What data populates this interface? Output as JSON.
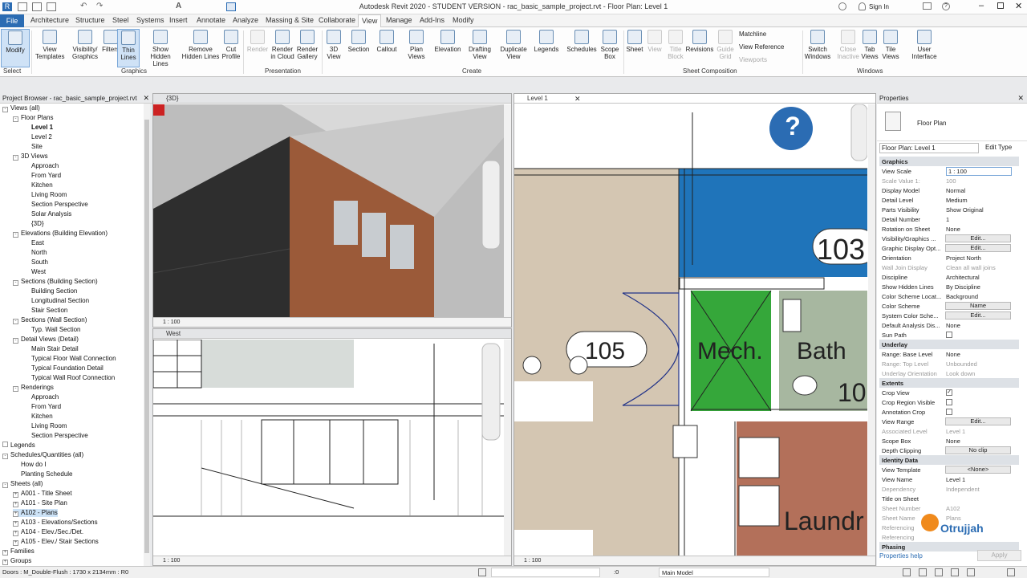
{
  "app": {
    "title": "Autodesk Revit 2020 - STUDENT VERSION - rac_basic_sample_project.rvt - Floor Plan: Level 1",
    "signin": "Sign In"
  },
  "tabs": [
    "File",
    "Architecture",
    "Structure",
    "Steel",
    "Systems",
    "Insert",
    "Annotate",
    "Analyze",
    "Massing & Site",
    "Collaborate",
    "View",
    "Manage",
    "Add-Ins",
    "Modify"
  ],
  "active_tab": "View",
  "ribbon": {
    "buttons": [
      {
        "id": "modify",
        "label": "Modify"
      },
      {
        "id": "view-templates",
        "label": "View\nTemplates"
      },
      {
        "id": "visibility-graphics",
        "label": "Visibility/\nGraphics"
      },
      {
        "id": "filters",
        "label": "Filters"
      },
      {
        "id": "thin-lines",
        "label": "Thin\nLines"
      },
      {
        "id": "show-hidden-lines",
        "label": "Show\nHidden Lines"
      },
      {
        "id": "remove-hidden-lines",
        "label": "Remove\nHidden Lines"
      },
      {
        "id": "cut-profile",
        "label": "Cut\nProfile"
      },
      {
        "id": "render",
        "label": "Render"
      },
      {
        "id": "render-in-cloud",
        "label": "Render\nin Cloud"
      },
      {
        "id": "render-gallery",
        "label": "Render\nGallery"
      },
      {
        "id": "3d-view",
        "label": "3D\nView"
      },
      {
        "id": "section",
        "label": "Section"
      },
      {
        "id": "callout",
        "label": "Callout"
      },
      {
        "id": "plan-views",
        "label": "Plan\nViews"
      },
      {
        "id": "elevation",
        "label": "Elevation"
      },
      {
        "id": "drafting-view",
        "label": "Drafting\nView"
      },
      {
        "id": "duplicate-view",
        "label": "Duplicate\nView"
      },
      {
        "id": "legends",
        "label": "Legends"
      },
      {
        "id": "schedules",
        "label": "Schedules"
      },
      {
        "id": "scope-box",
        "label": "Scope\nBox"
      },
      {
        "id": "sheet",
        "label": "Sheet"
      },
      {
        "id": "view",
        "label": "View"
      },
      {
        "id": "title-block",
        "label": "Title\nBlock"
      },
      {
        "id": "revisions",
        "label": "Revisions"
      },
      {
        "id": "guide-grid",
        "label": "Guide\nGrid"
      },
      {
        "id": "switch-windows",
        "label": "Switch\nWindows"
      },
      {
        "id": "close-inactive",
        "label": "Close\nInactive"
      },
      {
        "id": "tab-views",
        "label": "Tab\nViews"
      },
      {
        "id": "tile-views",
        "label": "Tile\nViews"
      },
      {
        "id": "user-interface",
        "label": "User\nInterface"
      }
    ],
    "small": [
      "Matchline",
      "View Reference",
      "Viewports"
    ],
    "panels": [
      "Select",
      "Graphics",
      "Presentation",
      "Create",
      "Sheet Composition",
      "Windows"
    ]
  },
  "browser": {
    "title": "Project Browser - rac_basic_sample_project.rvt",
    "items": [
      {
        "t": "Views (all)",
        "l": 1,
        "g": "-"
      },
      {
        "t": "Floor Plans",
        "l": 2,
        "g": "-"
      },
      {
        "t": "Level 1",
        "l": 3,
        "b": true
      },
      {
        "t": "Level 2",
        "l": 3
      },
      {
        "t": "Site",
        "l": 3
      },
      {
        "t": "3D Views",
        "l": 2,
        "g": "-"
      },
      {
        "t": "Approach",
        "l": 3
      },
      {
        "t": "From Yard",
        "l": 3
      },
      {
        "t": "Kitchen",
        "l": 3
      },
      {
        "t": "Living Room",
        "l": 3
      },
      {
        "t": "Section Perspective",
        "l": 3
      },
      {
        "t": "Solar Analysis",
        "l": 3
      },
      {
        "t": "{3D}",
        "l": 3
      },
      {
        "t": "Elevations (Building Elevation)",
        "l": 2,
        "g": "-"
      },
      {
        "t": "East",
        "l": 3
      },
      {
        "t": "North",
        "l": 3
      },
      {
        "t": "South",
        "l": 3
      },
      {
        "t": "West",
        "l": 3
      },
      {
        "t": "Sections (Building Section)",
        "l": 2,
        "g": "-"
      },
      {
        "t": "Building Section",
        "l": 3
      },
      {
        "t": "Longitudinal Section",
        "l": 3
      },
      {
        "t": "Stair Section",
        "l": 3
      },
      {
        "t": "Sections (Wall Section)",
        "l": 2,
        "g": "-"
      },
      {
        "t": "Typ. Wall Section",
        "l": 3
      },
      {
        "t": "Detail Views (Detail)",
        "l": 2,
        "g": "-"
      },
      {
        "t": "Main Stair Detail",
        "l": 3
      },
      {
        "t": "Typical Floor Wall Connection",
        "l": 3
      },
      {
        "t": "Typical Foundation Detail",
        "l": 3
      },
      {
        "t": "Typical Wall Roof Connection",
        "l": 3
      },
      {
        "t": "Renderings",
        "l": 2,
        "g": "-"
      },
      {
        "t": "Approach",
        "l": 3
      },
      {
        "t": "From Yard",
        "l": 3
      },
      {
        "t": "Kitchen",
        "l": 3
      },
      {
        "t": "Living Room",
        "l": 3
      },
      {
        "t": "Section Perspective",
        "l": 3
      },
      {
        "t": "Legends",
        "l": 1,
        "g": " "
      },
      {
        "t": "Schedules/Quantities (all)",
        "l": 1,
        "g": "-"
      },
      {
        "t": "How do I",
        "l": 2
      },
      {
        "t": "Planting Schedule",
        "l": 2
      },
      {
        "t": "Sheets (all)",
        "l": 1,
        "g": "-"
      },
      {
        "t": "A001 - Title Sheet",
        "l": 2,
        "g": "+"
      },
      {
        "t": "A101 - Site Plan",
        "l": 2,
        "g": "+"
      },
      {
        "t": "A102 - Plans",
        "l": 2,
        "g": "+",
        "sel": true
      },
      {
        "t": "A103 - Elevations/Sections",
        "l": 2,
        "g": "+"
      },
      {
        "t": "A104 - Elev./Sec./Det.",
        "l": 2,
        "g": "+"
      },
      {
        "t": "A105 - Elev./ Stair Sections",
        "l": 2,
        "g": "+"
      },
      {
        "t": "Families",
        "l": 1,
        "g": "+"
      },
      {
        "t": "Groups",
        "l": 1,
        "g": "+"
      }
    ]
  },
  "views": {
    "v3d": {
      "title": "{3D}",
      "scale": "1 : 100"
    },
    "west": {
      "title": "West",
      "scale": "1 : 100"
    },
    "level1": {
      "title": "Level 1",
      "scale": "1 : 100"
    },
    "rooms": [
      "103",
      "105",
      "Mech.",
      "Bath",
      "10",
      "Laundr"
    ]
  },
  "properties": {
    "title": "Properties",
    "type": "Floor Plan",
    "instance": "Floor Plan: Level 1",
    "edit_type": "Edit Type",
    "rows": [
      {
        "k": "Graphics",
        "grp": true
      },
      {
        "k": "View Scale",
        "v": "1 : 100",
        "inp": true
      },
      {
        "k": "Scale Value    1:",
        "v": "100",
        "dis": true
      },
      {
        "k": "Display Model",
        "v": "Normal"
      },
      {
        "k": "Detail Level",
        "v": "Medium"
      },
      {
        "k": "Parts Visibility",
        "v": "Show Original"
      },
      {
        "k": "Detail Number",
        "v": "1"
      },
      {
        "k": "Rotation on Sheet",
        "v": "None"
      },
      {
        "k": "Visibility/Graphics ...",
        "btn": "Edit..."
      },
      {
        "k": "Graphic Display Opt...",
        "btn": "Edit..."
      },
      {
        "k": "Orientation",
        "v": "Project North"
      },
      {
        "k": "Wall Join Display",
        "v": "Clean all wall joins",
        "dis": true
      },
      {
        "k": "Discipline",
        "v": "Architectural"
      },
      {
        "k": "Show Hidden Lines",
        "v": "By Discipline"
      },
      {
        "k": "Color Scheme Locat...",
        "v": "Background"
      },
      {
        "k": "Color Scheme",
        "btn": "Name"
      },
      {
        "k": "System Color Sche...",
        "btn": "Edit..."
      },
      {
        "k": "Default Analysis Dis...",
        "v": "None"
      },
      {
        "k": "Sun Path",
        "chk": false
      },
      {
        "k": "Underlay",
        "grp": true
      },
      {
        "k": "Range: Base Level",
        "v": "None"
      },
      {
        "k": "Range: Top Level",
        "v": "Unbounded",
        "dis": true
      },
      {
        "k": "Underlay Orientation",
        "v": "Look down",
        "dis": true
      },
      {
        "k": "Extents",
        "grp": true
      },
      {
        "k": "Crop View",
        "chk": true
      },
      {
        "k": "Crop Region Visible",
        "chk": false
      },
      {
        "k": "Annotation Crop",
        "chk": false
      },
      {
        "k": "View Range",
        "btn": "Edit..."
      },
      {
        "k": "Associated Level",
        "v": "Level 1",
        "dis": true
      },
      {
        "k": "Scope Box",
        "v": "None"
      },
      {
        "k": "Depth Clipping",
        "btn": "No clip"
      },
      {
        "k": "Identity Data",
        "grp": true
      },
      {
        "k": "View Template",
        "btn": "<None>"
      },
      {
        "k": "View Name",
        "v": "Level 1"
      },
      {
        "k": "Dependency",
        "v": "Independent",
        "dis": true
      },
      {
        "k": "Title on Sheet",
        "v": ""
      },
      {
        "k": "Sheet Number",
        "v": "A102",
        "dis": true
      },
      {
        "k": "Sheet Name",
        "v": "Plans",
        "dis": true
      },
      {
        "k": "Referencing",
        "v": "",
        "dis": true
      },
      {
        "k": "Referencing",
        "v": "",
        "dis": true
      },
      {
        "k": "Phasing",
        "grp": true
      }
    ],
    "help": "Properties help",
    "apply": "Apply"
  },
  "status": {
    "text": "Doors : M_Double-Flush : 1730 x 2134mm : R0",
    "coord": ":0",
    "model": "Main Model"
  },
  "watermark": "Otrujjah",
  "colors": {
    "accent": "#2b6cb3",
    "green": "#35a73a",
    "blue": "#1f74ba",
    "brick": "#b3705a",
    "sage": "#a7b7a0"
  }
}
